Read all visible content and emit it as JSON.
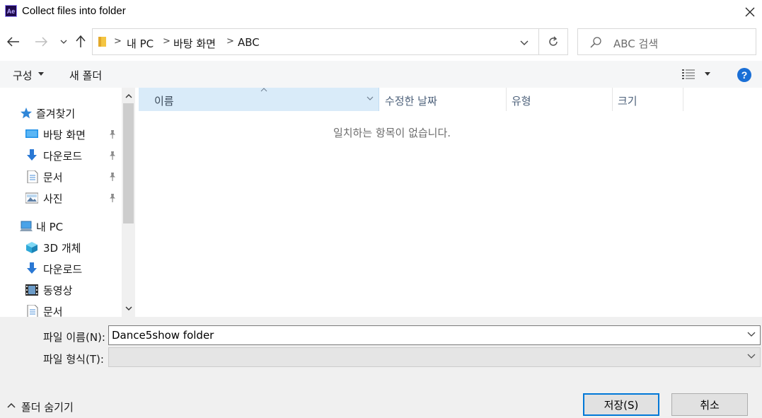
{
  "window": {
    "app_icon_text": "Ae",
    "title": "Collect files into folder"
  },
  "address": {
    "breadcrumbs": [
      "내 PC",
      "바탕 화면",
      "ABC"
    ]
  },
  "search": {
    "placeholder": "ABC 검색"
  },
  "toolbar": {
    "organize_label": "구성",
    "new_folder_label": "새 폴더",
    "help_label": "?"
  },
  "sidebar": {
    "quick_access": {
      "label": "즐겨찾기",
      "icon": "star-icon"
    },
    "quick_items": [
      {
        "label": "바탕 화면",
        "icon": "desktop-icon",
        "pinned": true
      },
      {
        "label": "다운로드",
        "icon": "download-icon",
        "pinned": true
      },
      {
        "label": "문서",
        "icon": "document-icon",
        "pinned": true
      },
      {
        "label": "사진",
        "icon": "picture-icon",
        "pinned": true
      }
    ],
    "this_pc": {
      "label": "내 PC",
      "icon": "computer-icon"
    },
    "pc_items": [
      {
        "label": "3D 개체",
        "icon": "cube-icon"
      },
      {
        "label": "다운로드",
        "icon": "download-icon"
      },
      {
        "label": "동영상",
        "icon": "video-icon"
      },
      {
        "label": "문서",
        "icon": "document-icon"
      }
    ]
  },
  "filelist": {
    "columns": [
      "이름",
      "수정한 날짜",
      "유형",
      "크기"
    ],
    "empty_message": "일치하는 항목이 없습니다."
  },
  "form": {
    "filename_label": "파일 이름(N):",
    "filename_value": "Dance5show folder",
    "filetype_label": "파일 형식(T):",
    "filetype_value": ""
  },
  "footer": {
    "hide_folders_label": "폴더 숨기기",
    "save_label": "저장(S)",
    "cancel_label": "취소"
  },
  "colors": {
    "accent": "#0078d7",
    "help": "#1a6fd6",
    "selected_column": "#d9ebf9"
  }
}
